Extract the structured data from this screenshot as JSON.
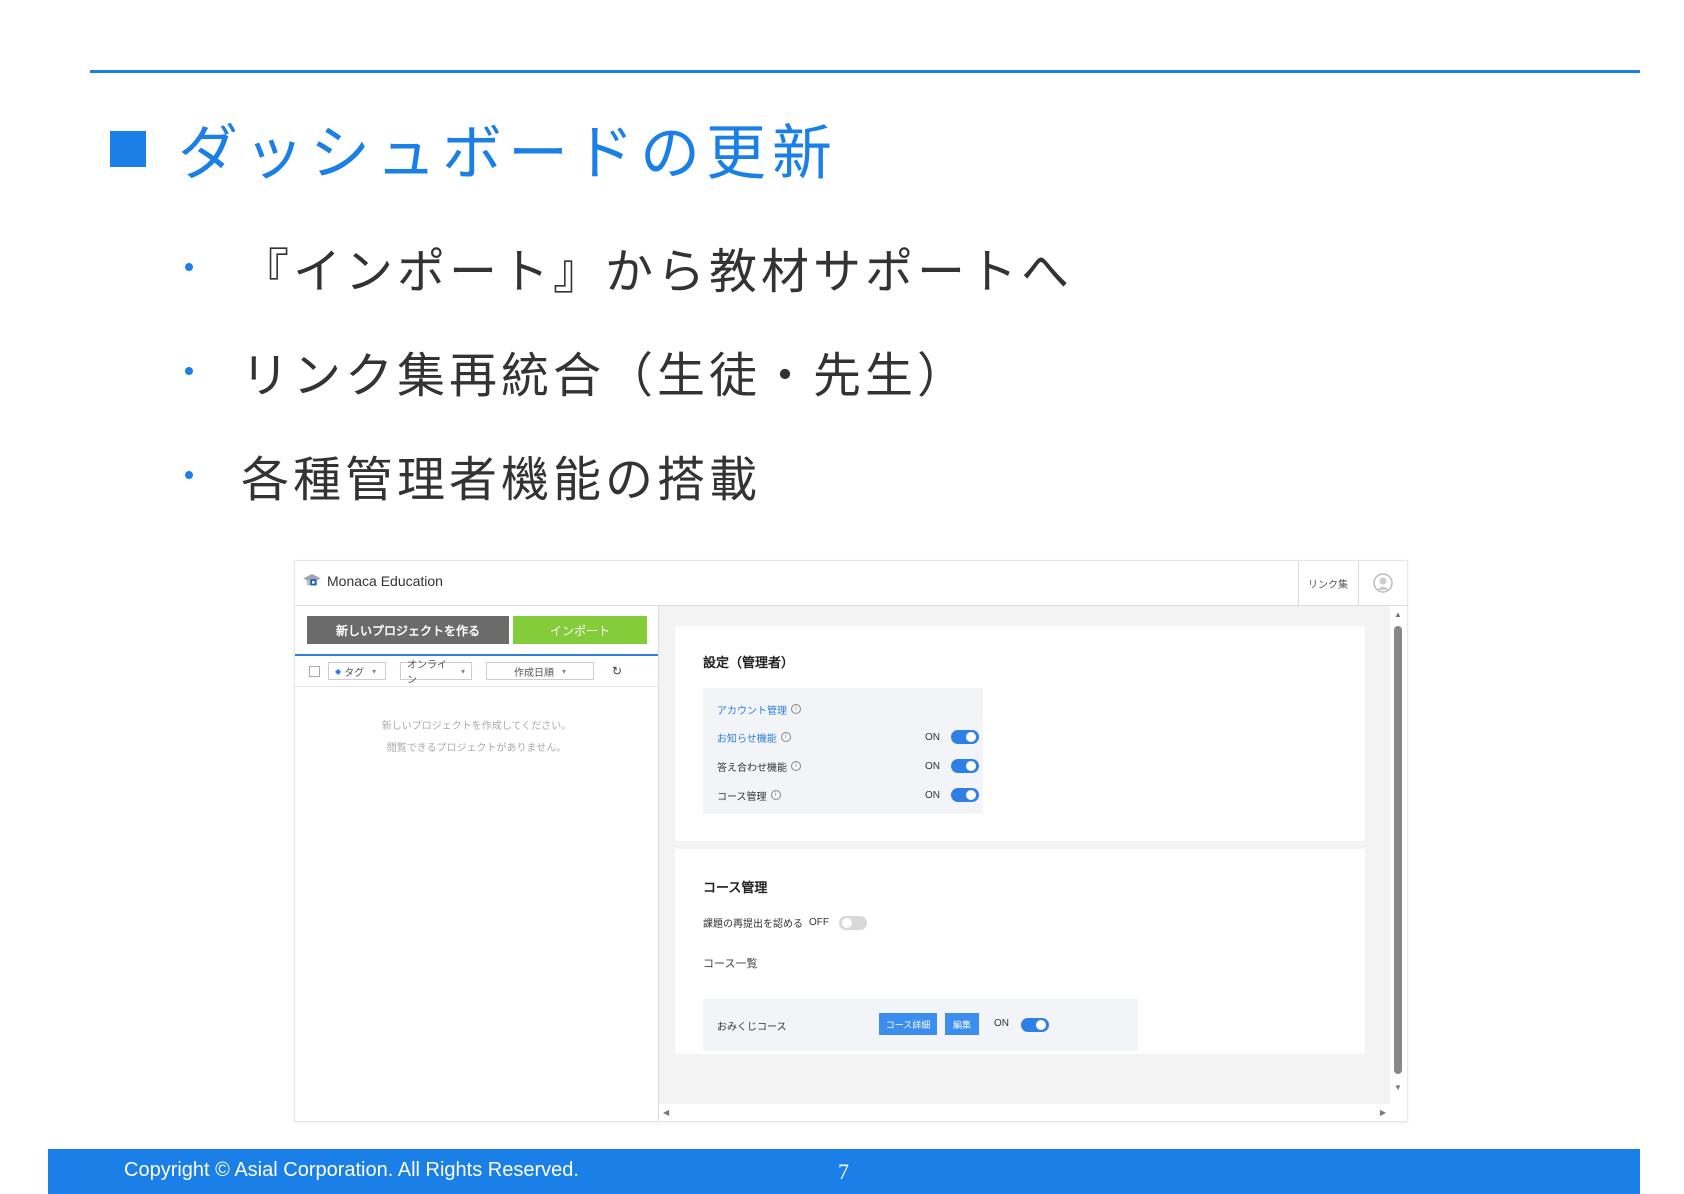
{
  "slide": {
    "title": "ダッシュボードの更新",
    "bullets": [
      "『インポート』から教材サポートへ",
      "リンク集再統合（生徒・先生）",
      "各種管理者機能の搭載"
    ]
  },
  "app": {
    "logo_text": "Monaca Education",
    "header_link": "リンク集",
    "new_project_button": "新しいプロジェクトを作る",
    "import_button": "インポート",
    "filters": {
      "tag": "タグ",
      "online": "オンライン",
      "sort": "作成日順"
    },
    "empty_messages": [
      "新しいプロジェクトを作成してください。",
      "閲覧できるプロジェクトがありません。"
    ],
    "settings_card": {
      "title": "設定（管理者）",
      "rows": [
        {
          "label": "アカウント管理",
          "state": ""
        },
        {
          "label": "お知らせ機能",
          "state": "ON"
        },
        {
          "label": "答え合わせ機能",
          "state": "ON"
        },
        {
          "label": "コース管理",
          "state": "ON"
        }
      ]
    },
    "course_card": {
      "title": "コース管理",
      "resubmit_label": "課題の再提出を認める",
      "resubmit_state": "OFF",
      "list_title": "コース一覧",
      "course_name": "おみくじコース",
      "detail_button": "コース詳細",
      "edit_button": "編集",
      "course_state": "ON"
    }
  },
  "footer": {
    "copyright": "Copyright ©  Asial Corporation. All Rights Reserved.",
    "page_number": "7"
  },
  "colors": {
    "accent": "#1a7fe6",
    "import_green": "#84cc3a",
    "toggle_blue": "#2f7fe6"
  }
}
